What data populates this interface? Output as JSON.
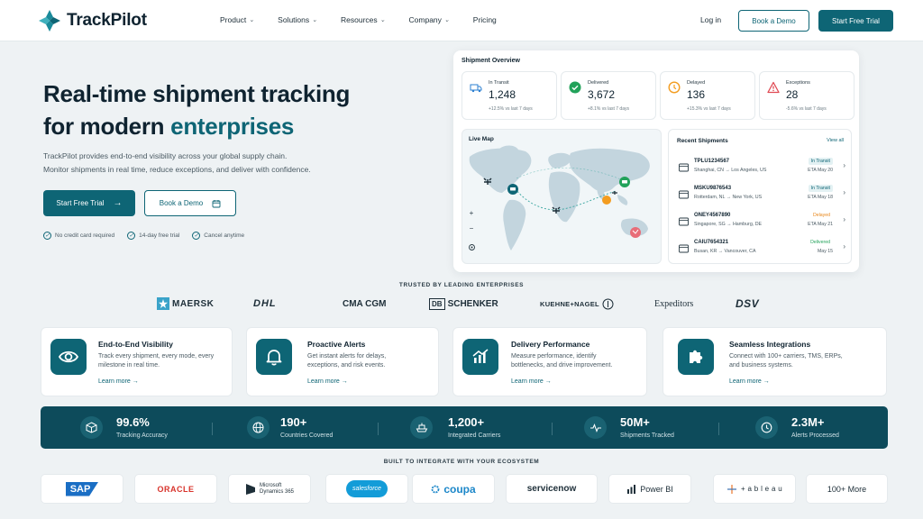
{
  "brand": {
    "name": "TrackPilot"
  },
  "nav": {
    "links": [
      "Product",
      "Solutions",
      "Resources",
      "Company",
      "Pricing"
    ],
    "login": "Log in",
    "demo": "Book a Demo",
    "trial": "Start Free Trial"
  },
  "hero": {
    "title_line1": "Real-time shipment tracking",
    "title_line2_pre": "for modern ",
    "title_line2_accent": "enterprises",
    "desc_line1": "TrackPilot provides end-to-end visibility across your global supply chain.",
    "desc_line2": "Monitor shipments in real time, reduce exceptions, and deliver with confidence.",
    "cta_trial": "Start Free Trial",
    "cta_demo": "Book a Demo",
    "checks": [
      "No credit card required",
      "14-day free trial",
      "Cancel anytime"
    ]
  },
  "dashboard": {
    "title": "Shipment Overview",
    "stats": [
      {
        "label": "In Transit",
        "value": "1,248",
        "sub": "+12.5% vs last 7 days",
        "color": "#2b7fd1",
        "icon": "truck-icon"
      },
      {
        "label": "Delivered",
        "value": "3,672",
        "sub": "+8.1% vs last 7 days",
        "color": "#22a25a",
        "icon": "check-icon"
      },
      {
        "label": "Delayed",
        "value": "136",
        "sub": "+15.3% vs last 7 days",
        "color": "#f39c1f",
        "icon": "clock-icon"
      },
      {
        "label": "Exceptions",
        "value": "28",
        "sub": "-5.6% vs last 7 days",
        "color": "#e04b54",
        "icon": "warning-icon"
      }
    ],
    "map_title": "Live Map",
    "zoom_in": "+",
    "zoom_out": "−",
    "recent_title": "Recent Shipments",
    "view_all": "View all",
    "shipments": [
      {
        "id": "TPLU1234567",
        "route": "Shanghai, CN → Los Angeles, US",
        "status": "In Transit",
        "eta": "ETA May 20",
        "color": "#0e6575",
        "bg": "#e3f1f3"
      },
      {
        "id": "MSKU9876543",
        "route": "Rotterdam, NL → New York, US",
        "status": "In Transit",
        "eta": "ETA May 18",
        "color": "#0e6575",
        "bg": "#e3f1f3"
      },
      {
        "id": "ONEY4567890",
        "route": "Singapore, SG → Hamburg, DE",
        "status": "Delayed",
        "eta": "ETA May 21",
        "color": "#e8871a",
        "bg": "#ffffff"
      },
      {
        "id": "CAIU7654321",
        "route": "Busan, KR → Vancouver, CA",
        "status": "Delivered",
        "eta": "May 15",
        "color": "#22a25a",
        "bg": "#ffffff"
      }
    ]
  },
  "trusted": {
    "title": "TRUSTED BY LEADING ENTERPRISES",
    "brands": [
      "MAERSK",
      "DHL",
      "CMA CGM",
      "SCHENKER",
      "KUEHNE+NAGEL",
      "Expeditors",
      "DSV"
    ]
  },
  "features": [
    {
      "title": "End-to-End Visibility",
      "desc": "Track every shipment, every mode, every milestone in real time.",
      "link": "Learn more →",
      "icon": "eye-icon"
    },
    {
      "title": "Proactive Alerts",
      "desc": "Get instant alerts for delays, exceptions, and risk events.",
      "link": "Learn more →",
      "icon": "bell-icon"
    },
    {
      "title": "Delivery Performance",
      "desc": "Measure performance, identify bottlenecks, and drive improvement.",
      "link": "Learn more →",
      "icon": "bar-chart-icon"
    },
    {
      "title": "Seamless Integrations",
      "desc": "Connect with 100+ carriers, TMS, ERPs, and business systems.",
      "link": "Learn more →",
      "icon": "puzzle-icon"
    }
  ],
  "stats_bar": [
    {
      "value": "99.6%",
      "label": "Tracking Accuracy",
      "icon": "box-icon"
    },
    {
      "value": "190+",
      "label": "Countries Covered",
      "icon": "globe-icon"
    },
    {
      "value": "1,200+",
      "label": "Integrated Carriers",
      "icon": "ship-icon"
    },
    {
      "value": "50M+",
      "label": "Shipments Tracked",
      "icon": "pulse-icon"
    },
    {
      "value": "2.3M+",
      "label": "Alerts Processed",
      "icon": "clock-icon"
    }
  ],
  "ecosystem": {
    "title": "BUILT TO INTEGRATE WITH YOUR ECOSYSTEM",
    "items": [
      "SAP",
      "ORACLE",
      "Microsoft",
      "Dynamics 365",
      "salesforce",
      "coupa",
      "servicenow",
      "Power BI",
      "+ a b l e a u",
      "100+ More"
    ]
  },
  "colors": {
    "primary": "#0e6575",
    "dark": "#0d4b5b"
  }
}
